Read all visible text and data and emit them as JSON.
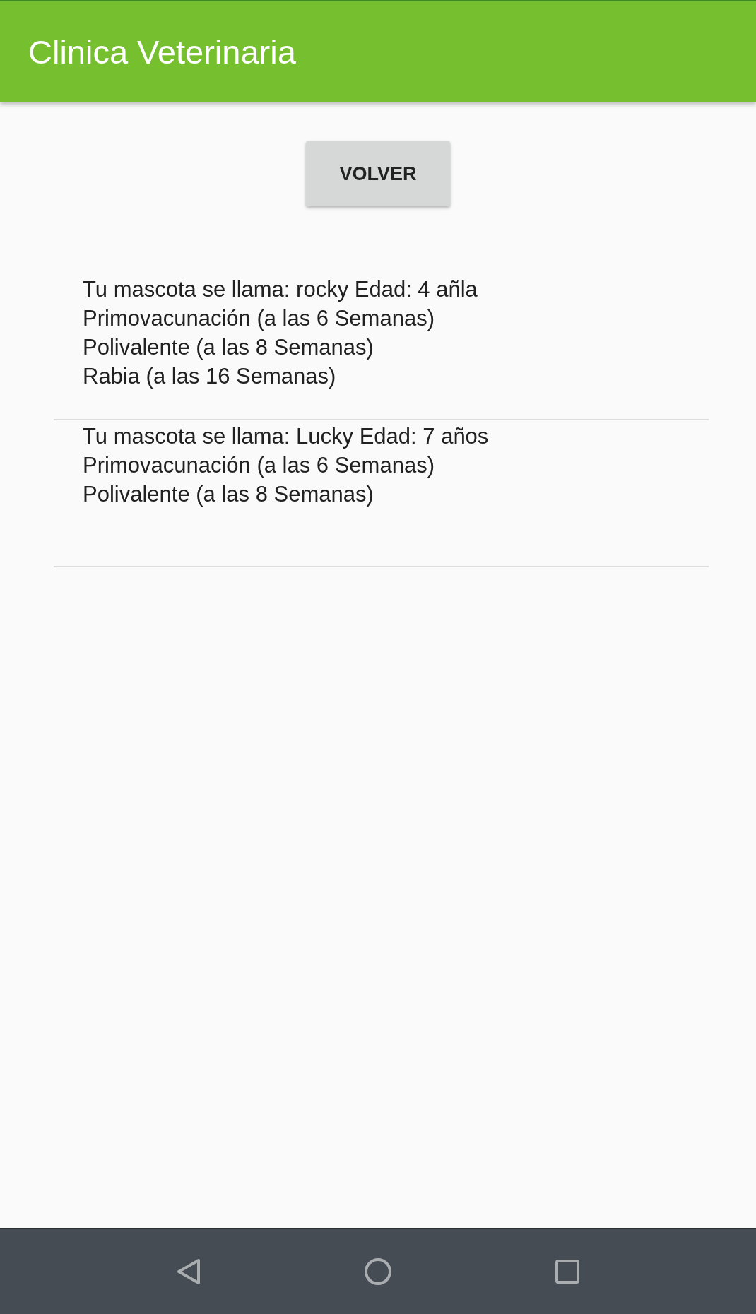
{
  "app_bar": {
    "title": "Clinica Veterinaria"
  },
  "back_button": {
    "label": "VOLVER"
  },
  "pets": [
    {
      "lines": [
        "Tu mascota se llama: rocky Edad: 4 añla",
        "Primovacunación (a las 6 Semanas)",
        "Polivalente (a las 8 Semanas)",
        "Rabia (a las 16 Semanas)"
      ]
    },
    {
      "lines": [
        "Tu mascota se llama: Lucky Edad: 7 años",
        "Primovacunación (a las 6 Semanas)",
        "Polivalente (a las 8 Semanas)"
      ]
    }
  ]
}
